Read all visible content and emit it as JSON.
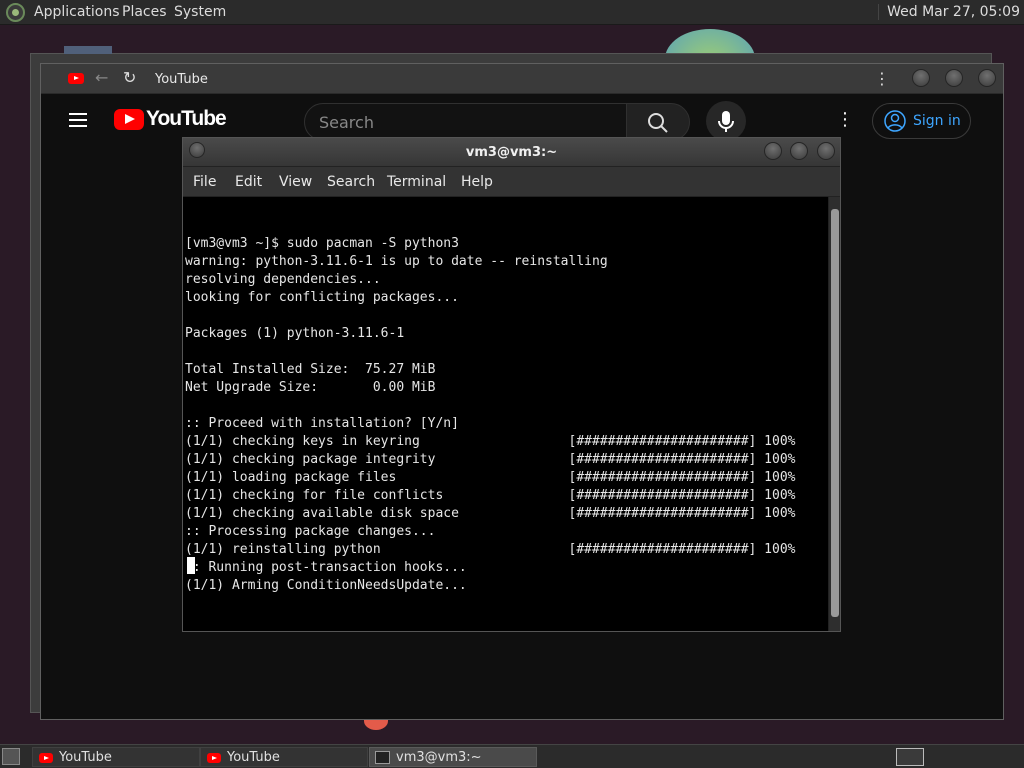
{
  "top_panel": {
    "menus": [
      "Applications",
      "Places",
      "System"
    ],
    "clock": "Wed Mar 27, 05:09"
  },
  "browser": {
    "tab_title": "YouTube",
    "youtube": {
      "logo_text": "YouTube",
      "search_placeholder": "Search",
      "sign_in_label": "Sign in"
    }
  },
  "terminal": {
    "title": "vm3@vm3:~",
    "menu": [
      "File",
      "Edit",
      "View",
      "Search",
      "Terminal",
      "Help"
    ],
    "lines": [
      "[vm3@vm3 ~]$ sudo pacman -S python3",
      "warning: python-3.11.6-1 is up to date -- reinstalling",
      "resolving dependencies...",
      "looking for conflicting packages...",
      "",
      "Packages (1) python-3.11.6-1",
      "",
      "Total Installed Size:  75.27 MiB",
      "Net Upgrade Size:       0.00 MiB",
      "",
      ":: Proceed with installation? [Y/n]",
      "(1/1) checking keys in keyring                   [######################] 100%",
      "(1/1) checking package integrity                 [######################] 100%",
      "(1/1) loading package files                      [######################] 100%",
      "(1/1) checking for file conflicts                [######################] 100%",
      "(1/1) checking available disk space              [######################] 100%",
      ":: Processing package changes...",
      "(1/1) reinstalling python                        [######################] 100%",
      ":: Running post-transaction hooks...",
      "(1/1) Arming ConditionNeedsUpdate..."
    ]
  },
  "taskbar": {
    "tasks": [
      {
        "label": "YouTube",
        "icon": "youtube-icon"
      },
      {
        "label": "YouTube",
        "icon": "youtube-icon"
      },
      {
        "label": "vm3@vm3:~",
        "icon": "terminal-icon"
      }
    ]
  },
  "colors": {
    "youtube_red": "#ff0000",
    "sign_in_blue": "#3ea6ff",
    "terminal_bg": "#000000"
  }
}
